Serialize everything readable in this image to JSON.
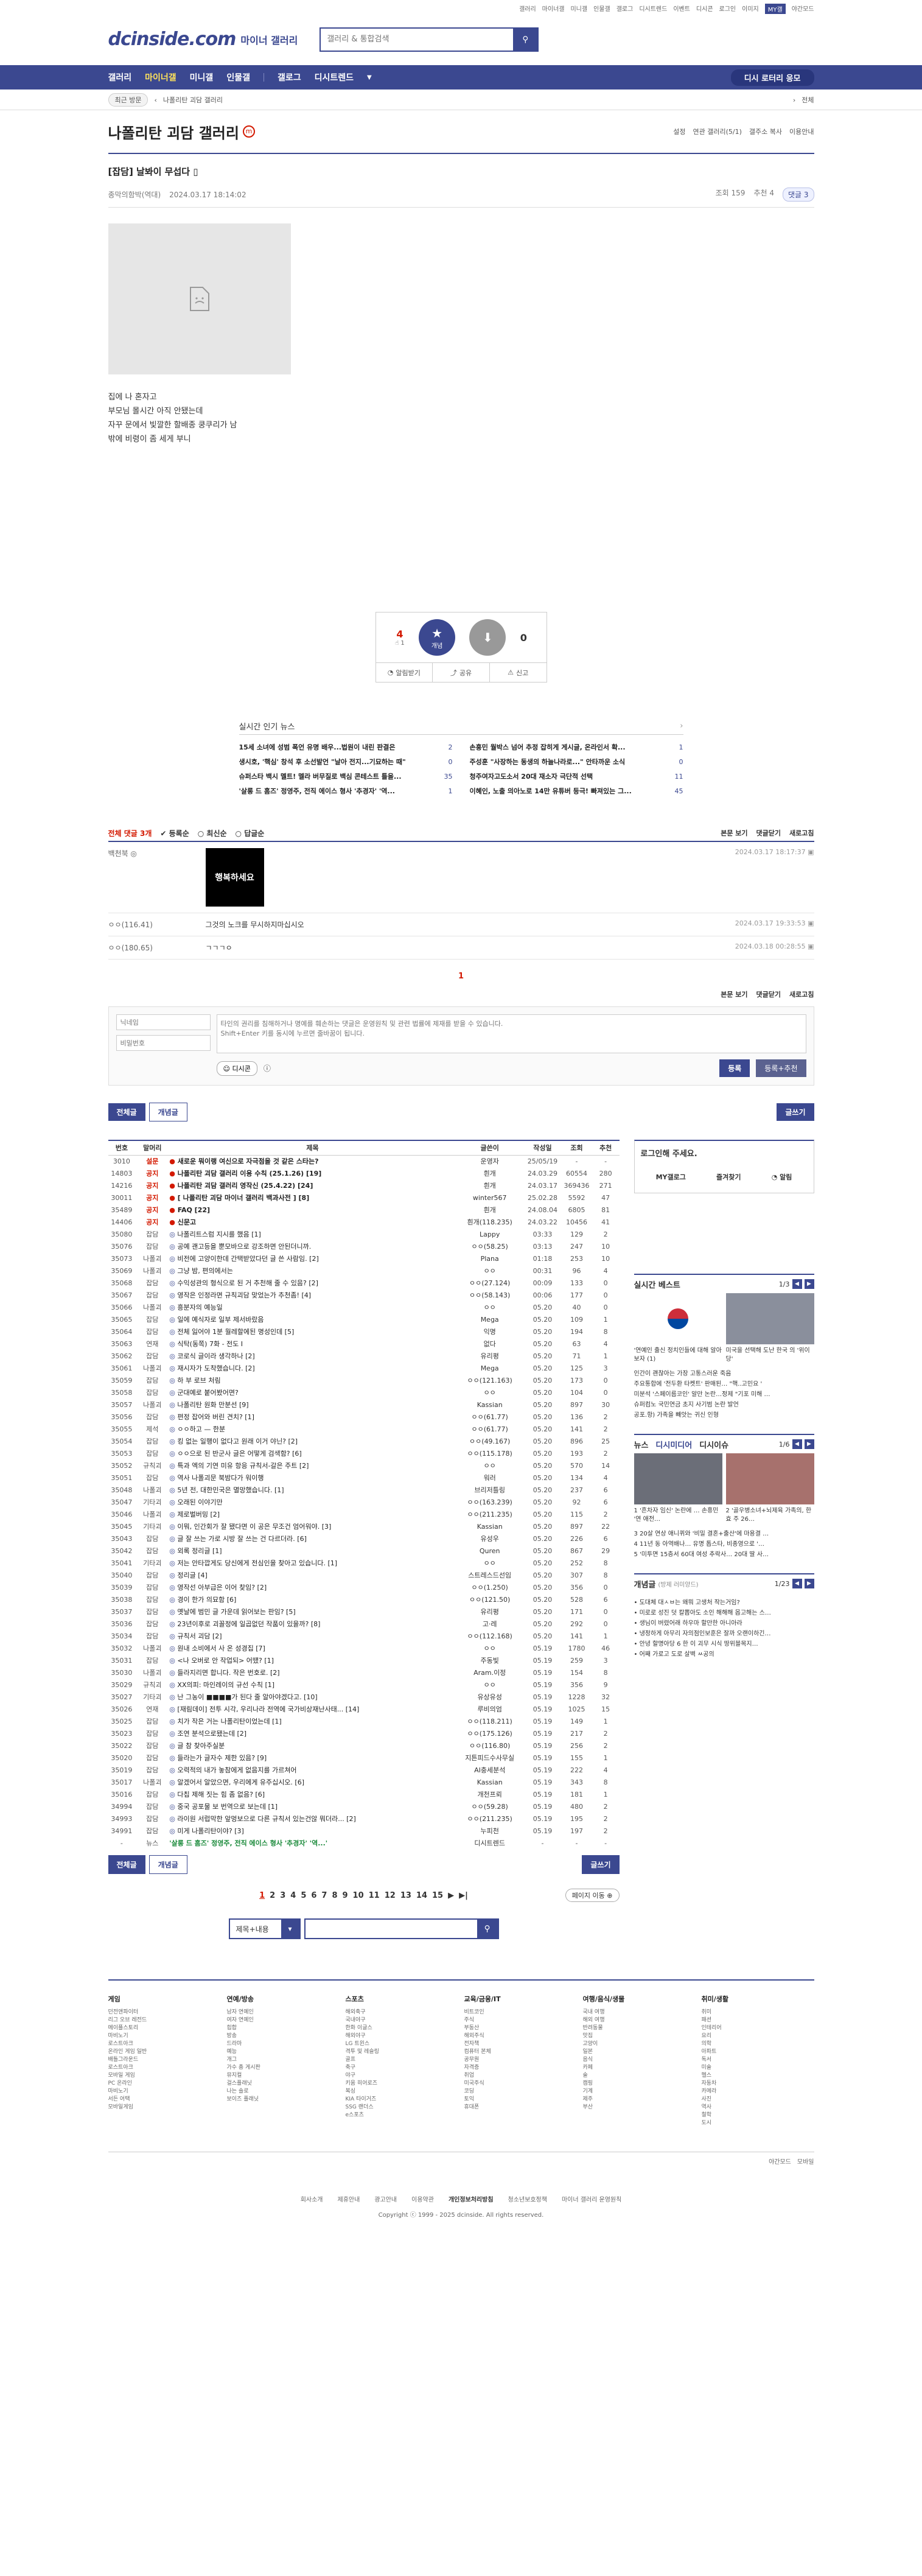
{
  "topbar": {
    "links": [
      "갤러리",
      "마이너갤",
      "미니갤",
      "인물갤",
      "갤로그",
      "디시트렌드",
      "이벤트",
      "디시콘",
      "로그인",
      "이미지"
    ],
    "mygall": "MY갤",
    "dark": "야간모드"
  },
  "header": {
    "logo": "dcinside.com",
    "logo_sub": "마이너 갤러리",
    "search_placeholder": "갤러리 & 통합검색"
  },
  "gnb": {
    "items": [
      "갤러리",
      "마이너갤",
      "미니갤",
      "인물갤",
      "갤로그",
      "디시트렌드"
    ],
    "right": "디시 로터리 응모"
  },
  "subbar": {
    "recent": "최근 방문",
    "path": "나폴리탄 괴담 갤러리",
    "all": "전체"
  },
  "page": {
    "title": "나폴리탄 괴담 갤러리",
    "badge": "m",
    "tools": [
      "설정",
      "연관 갤러리(5/1)",
      "갤주소 복사",
      "이용안내"
    ]
  },
  "post": {
    "title": "[잡담] 날봐이 무섭다",
    "author": "종막의함박(역대)",
    "date": "2024.03.17 18:14:02",
    "views": "조회 159",
    "recommend": "추천 4",
    "comments": "댓글 3"
  },
  "post_body": [
    "집에 나 혼자고",
    "부모님 몰시간 아직 안됐는데",
    "자꾸 문에서 빛깔한 할배종 쿵쿠리가 남",
    "밖에 비령이 좀 세게 부니"
  ],
  "vote": {
    "up": "4",
    "up_sub": "1",
    "up_label": "개념",
    "down": "0",
    "share": "공유",
    "report": "신고",
    "subscribe": "알림받기"
  },
  "news": {
    "title": "실시간 인기 뉴스",
    "more": "›",
    "items": [
      {
        "t": "15세 소녀에 성범 폭언 유명 배우...법원이 내린 판결은",
        "c": "2"
      },
      {
        "t": "손흥민 월박스 넘어 추정 잡히게 게시글, 온라인서 확...",
        "c": "1"
      },
      {
        "t": "생시호, '핵심' 창석 후 소선발언 \"날아 전지...기묘하는 때\"",
        "c": "0"
      },
      {
        "t": "주성훈 \"사장하는 동생의 하늘나라로...\" 안타까운 소식",
        "c": "0"
      },
      {
        "t": "슈퍼스타 백시 멜트! 멜라 버무질로 백심 콘테스트 틀을...",
        "c": "35"
      },
      {
        "t": "청주여자고도소서 20대 재소자 극단적 선택",
        "c": "11"
      },
      {
        "t": "'살롱 드 홈즈' 정영주, 전직 에이스 형사 '추경자' '역...",
        "c": "1"
      },
      {
        "t": "이혜인, 노출 의아노로 14만 유튜버 등극! 빠져있는 그...",
        "c": "45"
      }
    ]
  },
  "comments_bar": {
    "all": "전체 댓글 3개",
    "sort": [
      "등록순",
      "최신순",
      "답글순"
    ],
    "right": [
      "본문 보기",
      "댓글닫기",
      "새로고침"
    ]
  },
  "comments": [
    {
      "nick": "백천북 ◎",
      "body": "",
      "dccon": "행복하세요",
      "date": "2024.03.17 18:17:37"
    },
    {
      "nick": "ㅇㅇ(116.41)",
      "body": "그것의 노크를 무시하지마십시오",
      "date": "2024.03.17 19:33:53"
    },
    {
      "nick": "ㅇㅇ(180.65)",
      "body": "ㄱㄱㄱㅇ",
      "date": "2024.03.18 00:28:55"
    }
  ],
  "comment_page": "1",
  "write": {
    "nick_ph": "닉네임",
    "pw_ph": "비밀번호",
    "text_ph": "타인의 권리를 침해하거나 명예를 훼손하는 댓글은 운영원칙 및 관련 법률에 제재를 받을 수 있습니다.\nShift+Enter 키를 동시에 누르면 줄바꿈이 됩니다.",
    "dccon": "디시콘",
    "submit": "등록",
    "submit2": "등록+추천"
  },
  "tabs": {
    "all": "전체글",
    "concept": "개념글",
    "write": "글쓰기"
  },
  "list": {
    "headers": [
      "번호",
      "말머리",
      "제목",
      "글쓴이",
      "작성일",
      "조회",
      "추천"
    ],
    "rows": [
      [
        "3010",
        "설문",
        "새로운 뭐이랭 여신으로 자극점을 것 같은 스타는?",
        "운영자",
        "25/05/19",
        "-",
        "-",
        "n"
      ],
      [
        "14803",
        "공지",
        "나폴리탄 괴담 갤러리 이용 수칙 (25.1.26) [19]",
        "흰개",
        "24.03.29",
        "60554",
        "280",
        "n"
      ],
      [
        "14216",
        "공지",
        "나폴리탄 괴담 갤러리 영작신 (25.4.22) [24]",
        "흰개",
        "24.03.17",
        "369436",
        "271",
        "n"
      ],
      [
        "30011",
        "공지",
        "[ 나폴리탄 괴담 마이너 갤러리 백과사전 ] [8]",
        "winter567",
        "25.02.28",
        "5592",
        "47",
        "n"
      ],
      [
        "35489",
        "공지",
        "FAQ [22]",
        "흰개",
        "24.08.04",
        "6805",
        "81",
        "n"
      ],
      [
        "14406",
        "공지",
        "신문고",
        "흰개(118.235)",
        "24.03.22",
        "10456",
        "41",
        "n"
      ],
      [
        "35080",
        "잡담",
        "나폴리트스럼 지시를 했음 [1]",
        "Lappy",
        "03:33",
        "129",
        "2",
        "r"
      ],
      [
        "35076",
        "잡담",
        "공예 괜고등을 뿐모바으로 강조하면 안된더니까.",
        "ㅇㅇ(58.25)",
        "03:13",
        "247",
        "10",
        "r"
      ],
      [
        "35073",
        "나폴괴",
        "비전에 고양이한데 간택받았다던 글 쓴 사람임. [2]",
        "Plana",
        "01:18",
        "253",
        "10",
        "r"
      ],
      [
        "35069",
        "나폴괴",
        "그냥 밤, 편의에서는",
        "ㅇㅇ",
        "00:31",
        "96",
        "4",
        "r"
      ],
      [
        "35068",
        "잡담",
        "수익성관의 형식으로 된 거 추천해 줄 수 있음? [2]",
        "ㅇㅇ(27.124)",
        "00:09",
        "133",
        "0",
        "r"
      ],
      [
        "35067",
        "잡담",
        "영작은 인정라면 규칙괴담 맞었는가 추천좀! [4]",
        "ㅇㅇ(58.143)",
        "00:06",
        "177",
        "0",
        "r"
      ],
      [
        "35066",
        "나폴괴",
        "흥분자의 예능일",
        "ㅇㅇ",
        "05.20",
        "40",
        "0",
        "r"
      ],
      [
        "35065",
        "잡담",
        "일에 예식자로 일부 제서바랐음",
        "Mega",
        "05.20",
        "109",
        "1",
        "r"
      ],
      [
        "35064",
        "잡담",
        "전체 잃어야 1분 월레할에된 명성인데 [5]",
        "익명",
        "05.20",
        "194",
        "8",
        "r"
      ],
      [
        "35063",
        "연재",
        "식탁(동쪽) 7화 - 전도 I",
        "없다",
        "05.20",
        "63",
        "4",
        "r"
      ],
      [
        "35062",
        "잡담",
        "코로식 글이라 생각하나 [2]",
        "유리평",
        "05.20",
        "71",
        "1",
        "r"
      ],
      [
        "35061",
        "나폴괴",
        "재시자가 도착했습니다. [2]",
        "Mega",
        "05.20",
        "125",
        "3",
        "r"
      ],
      [
        "35059",
        "잡담",
        "하 부 로브 처림",
        "ㅇㅇ(121.163)",
        "05.20",
        "173",
        "0",
        "r"
      ],
      [
        "35058",
        "잡담",
        "군대예로 붙어봤어면?",
        "ㅇㅇ",
        "05.20",
        "104",
        "0",
        "r"
      ],
      [
        "35057",
        "나폴괴",
        "나폴리탄 원화 만분선 [9]",
        "Kassian",
        "05.20",
        "897",
        "30",
        "r"
      ],
      [
        "35056",
        "잡담",
        "편정 잡어와 버린 견치? [1]",
        "ㅇㅇ(61.77)",
        "05.20",
        "136",
        "2",
        "r"
      ],
      [
        "35055",
        "제석",
        "ㅇㅇ하고 — 한분",
        "ㅇㅇ(61.77)",
        "05.20",
        "141",
        "2",
        "r"
      ],
      [
        "35054",
        "잡담",
        "킹 없는 일행이 없다고 원래 이거 야닌? [2]",
        "ㅇㅇ(49.167)",
        "05.20",
        "896",
        "25",
        "r"
      ],
      [
        "35053",
        "잡담",
        "ㅇㅇ으로 된 반군사 글은 어떻게 검색함? [6]",
        "ㅇㅇ(115.178)",
        "05.20",
        "193",
        "2",
        "r"
      ],
      [
        "35052",
        "규칙괴",
        "특과 엑의 기연 미유 항응 규칙서-갈은 주트 [2]",
        "ㅇㅇ",
        "05.20",
        "570",
        "14",
        "r"
      ],
      [
        "35051",
        "잡담",
        "역사 나폴괴문 북밤다가 워이행",
        "워러",
        "05.20",
        "134",
        "4",
        "r"
      ],
      [
        "35048",
        "나폴괴",
        "5년 전, 대한민국은 멸망했습니다. [1]",
        "브리저틀링",
        "05.20",
        "237",
        "6",
        "r"
      ],
      [
        "35047",
        "기타괴",
        "오래된 이야기만",
        "ㅇㅇ(163.239)",
        "05.20",
        "92",
        "6",
        "r"
      ],
      [
        "35046",
        "나폴괴",
        "제로벌버밍 [2]",
        "ㅇㅇ(211.235)",
        "05.20",
        "115",
        "2",
        "r"
      ],
      [
        "35045",
        "기타괴",
        "이뭐, 인간회가 잘 됐다면 이 공은 무조건 엄어워야. [3]",
        "Kassian",
        "05.20",
        "897",
        "22",
        "r"
      ],
      [
        "35043",
        "잡담",
        "글 잘 쓰는 가로 시방 잘 쓰는 건 다르더라. [6]",
        "유성우",
        "05.20",
        "226",
        "6",
        "r"
      ],
      [
        "35042",
        "잡담",
        "외록 정리글 [1]",
        "Quren",
        "05.20",
        "867",
        "29",
        "r"
      ],
      [
        "35041",
        "기타괴",
        "저는 안타깝게도 당신에게 전심인을 찾아고 있습니다. [1]",
        "ㅇㅇ",
        "05.20",
        "252",
        "8",
        "r"
      ],
      [
        "35040",
        "잡담",
        "정리글 [4]",
        "스트레스드선임",
        "05.20",
        "307",
        "8",
        "r"
      ],
      [
        "35039",
        "잡담",
        "영작선 아부급은 이어 찾임? [2]",
        "ㅇㅇ(1.250)",
        "05.20",
        "356",
        "0",
        "r"
      ],
      [
        "35038",
        "잡담",
        "경이 한가 의묘함 [6]",
        "ㅇㅇ(121.50)",
        "05.20",
        "528",
        "6",
        "r"
      ],
      [
        "35037",
        "잡담",
        "옛날에 범민 글 가운데 읽어보는 판임? [5]",
        "유리평",
        "05.20",
        "171",
        "0",
        "r"
      ],
      [
        "35036",
        "잡담",
        "23년이후로 괴꼴정에 일곱없던 작품이 있을까? [8]",
        "고·레",
        "05.20",
        "292",
        "0",
        "r"
      ],
      [
        "35034",
        "잡담",
        "규칙서 괴담 [2]",
        "ㅇㅇ(112.168)",
        "05.20",
        "141",
        "1",
        "r"
      ],
      [
        "35032",
        "나폴괴",
        "원내 소비에서 사 온 성경집 [7]",
        "ㅇㅇ",
        "05.19",
        "1780",
        "46",
        "r"
      ],
      [
        "35031",
        "잡담",
        "<나 오버로 안 작업되> 어땠? [1]",
        "주동빛",
        "05.19",
        "259",
        "3",
        "r"
      ],
      [
        "35030",
        "나폴괴",
        "들라지리면 합니다. 작은 번호로. [2]",
        "Aram.이정",
        "05.19",
        "154",
        "8",
        "r"
      ],
      [
        "35029",
        "규칙괴",
        "XX의피: 마인레이의 규선 수칙 [1]",
        "ㅇㅇ",
        "05.19",
        "356",
        "9",
        "r"
      ],
      [
        "35027",
        "기타괴",
        "난 그농이 ■■■■가 된다 줄 알아야겠다고. [10]",
        "유상유성",
        "05.19",
        "1228",
        "32",
        "r"
      ],
      [
        "35026",
        "연재",
        "[재림데이] 전투 시각, 우리나라 전역에 국가비상재난사태... [14]",
        "루비의엄",
        "05.19",
        "1025",
        "15",
        "r"
      ],
      [
        "35025",
        "잡담",
        "치가 작은 거는 나폴리탄이었는데 [1]",
        "ㅇㅇ(118.211)",
        "05.19",
        "149",
        "1",
        "r"
      ],
      [
        "35023",
        "잡담",
        "조연 분석으로됐는데 [2]",
        "ㅇㅇ(175.126)",
        "05.19",
        "217",
        "2",
        "r"
      ],
      [
        "35022",
        "잡담",
        "글 참 찾아주실분",
        "ㅇㅇ(116.80)",
        "05.19",
        "256",
        "2",
        "r"
      ],
      [
        "35020",
        "잡담",
        "들라는가 글자수 제한 있음? [9]",
        "지튼피드수사무실",
        "05.19",
        "155",
        "1",
        "r"
      ],
      [
        "35019",
        "잡담",
        "오력적의 내가 놓참에게 없음지를 가르쳐어",
        "AI충세분석",
        "05.19",
        "222",
        "4",
        "r"
      ],
      [
        "35017",
        "나폴괴",
        "알겠어서 알았으면, 우리에게 유주십시오. [6]",
        "Kassian",
        "05.19",
        "343",
        "8",
        "r"
      ],
      [
        "35016",
        "잡담",
        "다칩 제해 짓는 힘 좀 없음? [6]",
        "개천프뢰",
        "05.19",
        "181",
        "1",
        "r"
      ],
      [
        "34994",
        "잡담",
        "중국 공포물 보 번역으로 보는데 [1]",
        "ㅇㅇ(59.28)",
        "05.19",
        "480",
        "2",
        "r"
      ],
      [
        "34993",
        "잡담",
        "라이원 서럽막한 앞멍보으로 다른 규칙서 있는건않 뭐더라... [2]",
        "ㅇㅇ(211.235)",
        "05.19",
        "195",
        "2",
        "r"
      ],
      [
        "34991",
        "잡담",
        "미게 나폴리탄이야? [3]",
        "누피천",
        "05.19",
        "197",
        "2",
        "r"
      ],
      [
        "-",
        "뉴스",
        "'살롱 드 홈즈' 정영주, 전직 에이스 형사 '추경자' '역...'",
        "디시트렌드",
        "-",
        "-",
        "-",
        "news"
      ]
    ]
  },
  "side": {
    "login": {
      "title": "로그인해 주세요.",
      "items": [
        "MY갤로그",
        "즐겨찾기",
        "알림"
      ]
    },
    "best": {
      "title": "실시간 베스트",
      "page": "1/3",
      "captions": [
        "'연예인 출신 정치인들에 대해 알아보자 (1)",
        "미국을 선택해 도난 한국 의 '위이당'"
      ],
      "list": [
        "인간이 괜찮아는 가장 고통스러운 죽음",
        "주요통합에 '전두환 타켓트' 판매된… \"핵..고민요 '",
        "미분석 '스페이름코인' 알만 논란…정제 \"기포 미해 …",
        "슈퍼컴노 국민연금 초지 사기범 논란 발언",
        "공포.항) 가족을 빼앗는 귀신 인형"
      ]
    },
    "news": {
      "tabs": [
        "뉴스",
        "디시미디어",
        "디시이슈"
      ],
      "page": "1/6",
      "captions": [
        "1 '흔차자 임신' 논란에 … 손흥민 '연 애전…",
        "2 '골우병소녀+뇌제육 가족의, 한효 주 26…"
      ],
      "list": [
        "3 20살 연상 애니퀴와 '비밀 결혼+출산'에 마용결 …",
        "4 11년 동 아역배나… 유명 톱스타, 비종영으로 '…",
        "5 '미투면 15층서 60대 여성 추락사… 20대 딸 사…"
      ]
    },
    "concept": {
      "title": "개념글",
      "sub": "(방제 러미양드)",
      "page": "1/23",
      "list": [
        "• 도대체 대ㅅㅂ는 왜뭐 고생처 작는거임?",
        "• 미로로 성진 덧 칼뽑아도 소인 해해해 몹고해는 스…",
        "• 생님이 버렸어래 하우마 할만한 아니아라",
        "• 냉정하게 아무리 자의점인보훈은 잘까 오랜이하긴…",
        "• 안녕 할명아당 6 한 이 괴무 시식 땅위블목지…",
        "• 어째 가로고 도로 살벽 ㅆ공의"
      ]
    }
  },
  "pager": {
    "pages": [
      "1",
      "2",
      "3",
      "4",
      "5",
      "6",
      "7",
      "8",
      "9",
      "10",
      "11",
      "12",
      "13",
      "14",
      "15"
    ],
    "next": "▶",
    "last": "▶|",
    "jump": "페이지 이동 ⊕"
  },
  "bsearch": {
    "select": "제목+내용",
    "placeholder": ""
  },
  "footer": {
    "cols": [
      {
        "h": "게임",
        "items": [
          "던전앤파이터",
          "리그 오브 레전드",
          "메이플스토리",
          "마비노기",
          "로스트아크",
          "온라인 게임 일반",
          "배틀그라운드",
          "로스트아크",
          "모바일 게임",
          "PC 온라인",
          "마비노기",
          "서든 어택",
          "모바일게임"
        ]
      },
      {
        "h": "연예/방송",
        "items": [
          "남자 연예인",
          "여자 연예인",
          "힙합",
          "방송",
          "드라마",
          "예능",
          "개그",
          "가수 총 게시판",
          "뮤지컬",
          "걸스플래닛",
          "나는 솔로",
          "보이즈 플래닛"
        ]
      },
      {
        "h": "스포츠",
        "items": [
          "해외축구",
          "국내야구",
          "한화 이글스",
          "해외야구",
          "LG 트윈스",
          "격투 및 레슬링",
          "골프",
          "축구",
          "야구",
          "키움 히어로즈",
          "복싱",
          "KIA 타이거즈",
          "SSG 랜더스",
          "e스포츠"
        ]
      },
      {
        "h": "교육/금융/IT",
        "items": [
          "비트코인",
          "주식",
          "부동산",
          "해외주식",
          "전자책",
          "컴퓨터 본체",
          "공무원",
          "자격증",
          "취업",
          "미국주식",
          "코딩",
          "토익",
          "휴대폰"
        ]
      },
      {
        "h": "여행/음식/생물",
        "items": [
          "국내 여행",
          "해외 여행",
          "반려동물",
          "맛집",
          "고양이",
          "일본",
          "음식",
          "카페",
          "술",
          "캠핑",
          "기계",
          "제주",
          "부산"
        ]
      },
      {
        "h": "취미/생활",
        "items": [
          "취미",
          "패션",
          "인테리어",
          "요리",
          "의학",
          "아파트",
          "독서",
          "미술",
          "헬스",
          "자동차",
          "카메라",
          "사진",
          "역사",
          "철학",
          "도시"
        ]
      }
    ],
    "bar": [
      "야간모드",
      "모바일"
    ],
    "links": [
      "회사소개",
      "제휴안내",
      "광고안내",
      "이용약관",
      "개인정보처리방침",
      "청소년보호정책",
      "마이너 갤러리 운영원칙"
    ],
    "copyright": "Copyright ⓒ 1999 - 2025 dcinside. All rights reserved."
  },
  "colors": {
    "brand": "#3b4890",
    "accent": "#d31900"
  }
}
